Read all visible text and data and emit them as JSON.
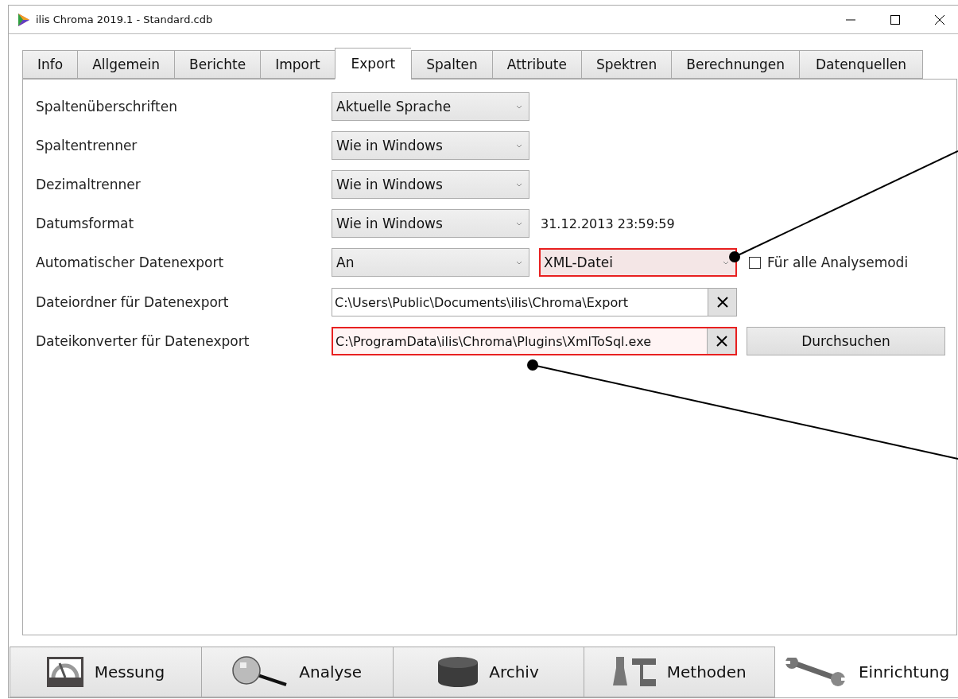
{
  "window": {
    "title": "ilis Chroma 2019.1 - Standard.cdb"
  },
  "tabs": [
    {
      "label": "Info",
      "selected": false
    },
    {
      "label": "Allgemein",
      "selected": false
    },
    {
      "label": "Berichte",
      "selected": false
    },
    {
      "label": "Import",
      "selected": false
    },
    {
      "label": "Export",
      "selected": true
    },
    {
      "label": "Spalten",
      "selected": false
    },
    {
      "label": "Attribute",
      "selected": false
    },
    {
      "label": "Spektren",
      "selected": false
    },
    {
      "label": "Berechnungen",
      "selected": false
    },
    {
      "label": "Datenquellen",
      "selected": false
    }
  ],
  "settings": [
    {
      "label": "Spaltenüberschriften",
      "controls": [
        {
          "kind": "combo",
          "value": "Aktuelle Sprache",
          "highlighted": false
        }
      ]
    },
    {
      "label": "Spaltentrenner",
      "controls": [
        {
          "kind": "combo",
          "value": "Wie in Windows",
          "highlighted": false
        }
      ]
    },
    {
      "label": "Dezimaltrenner",
      "controls": [
        {
          "kind": "combo",
          "value": "Wie in Windows",
          "highlighted": false
        }
      ]
    },
    {
      "label": "Datumsformat",
      "controls": [
        {
          "kind": "combo",
          "value": "Wie in Windows",
          "highlighted": false
        },
        {
          "kind": "text",
          "value": "31.12.2013 23:59:59"
        }
      ]
    },
    {
      "label": "Automatischer Datenexport",
      "controls": [
        {
          "kind": "combo",
          "value": "An",
          "highlighted": false
        },
        {
          "kind": "combo",
          "value": "XML-Datei",
          "highlighted": true
        },
        {
          "kind": "checkbox",
          "label": "Für alle Analysemodi",
          "checked": false
        }
      ]
    },
    {
      "label": "Dateiordner für Datenexport",
      "controls": [
        {
          "kind": "path",
          "value": "C:\\Users\\Public\\Documents\\ilis\\Chroma\\Export",
          "highlighted": false
        }
      ]
    },
    {
      "label": "Dateikonverter für Datenexport",
      "controls": [
        {
          "kind": "path",
          "value": "C:\\ProgramData\\ilis\\Chroma\\Plugins\\XmlToSql.exe",
          "highlighted": true
        },
        {
          "kind": "button",
          "label": "Durchsuchen"
        }
      ]
    }
  ],
  "navigation": [
    {
      "label": "Messung",
      "selected": false
    },
    {
      "label": "Analyse",
      "selected": false
    },
    {
      "label": "Archiv",
      "selected": false
    },
    {
      "label": "Methoden",
      "selected": false
    },
    {
      "label": "Einrichtung",
      "selected": true
    }
  ]
}
